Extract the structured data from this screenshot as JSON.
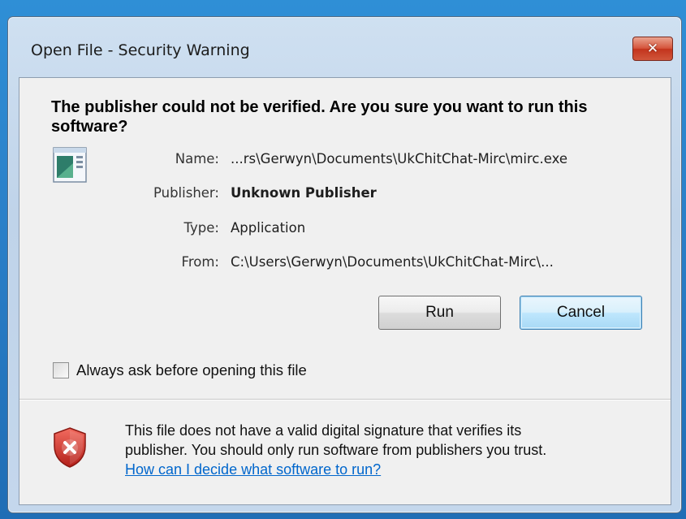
{
  "window": {
    "title": "Open File - Security Warning",
    "close_label": "✕"
  },
  "headline": "The publisher could not be verified.  Are you sure you want to run this software?",
  "details": [
    {
      "label": "Name:",
      "value": "...rs\\Gerwyn\\Documents\\UkChitChat-Mirc\\mirc.exe",
      "bold": false
    },
    {
      "label": "Publisher:",
      "value": "Unknown Publisher",
      "bold": true
    },
    {
      "label": "Type:",
      "value": "Application",
      "bold": false
    },
    {
      "label": "From:",
      "value": "C:\\Users\\Gerwyn\\Documents\\UkChitChat-Mirc\\...",
      "bold": false
    }
  ],
  "buttons": {
    "run": "Run",
    "cancel": "Cancel"
  },
  "checkbox": {
    "label": "Always ask before opening this file",
    "checked": false
  },
  "footer": {
    "line1": "This file does not have a valid digital signature that verifies its",
    "line2": "publisher.  You should only run software from publishers you trust.",
    "link": "How can I decide what software to run?"
  },
  "icons": {
    "app": "application-icon",
    "shield": "shield-error-icon",
    "close": "close-icon"
  },
  "colors": {
    "link": "#0066cc",
    "close_button": "#c3341d",
    "shield": "#c62828"
  }
}
